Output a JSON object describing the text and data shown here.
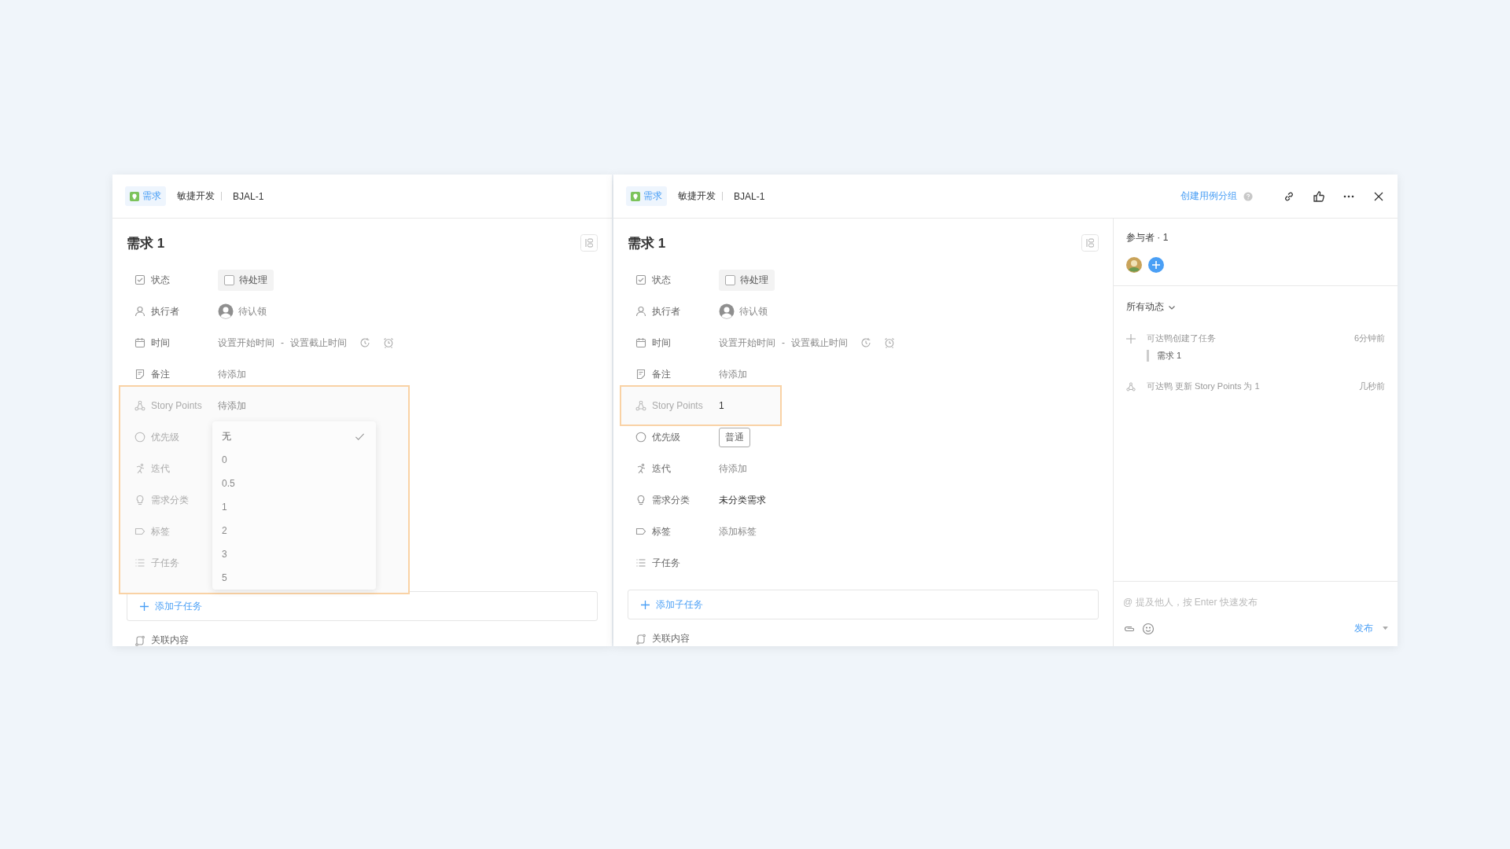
{
  "panels": [
    {
      "header": {
        "type_badge": "需求",
        "project": "敏捷开发",
        "key": "BJAL-1"
      },
      "title": "需求 1",
      "fields": [
        {
          "kind": "status",
          "label": "状态",
          "value": "待处理",
          "checked": false,
          "highlighted": false
        },
        {
          "kind": "assignee",
          "label": "执行者",
          "placeholder": "待认领",
          "highlighted": false
        },
        {
          "kind": "time",
          "label": "时间",
          "start_placeholder": "设置开始时间",
          "separator": "-",
          "end_placeholder": "设置截止时间",
          "highlighted": false
        },
        {
          "kind": "note",
          "label": "备注",
          "placeholder": "待添加",
          "highlighted": false
        },
        {
          "kind": "points",
          "label": "Story Points",
          "placeholder": "待添加",
          "highlighted": true
        },
        {
          "kind": "priority",
          "label": "优先级",
          "highlighted": true
        },
        {
          "kind": "iteration",
          "label": "迭代",
          "highlighted": true
        },
        {
          "kind": "category",
          "label": "需求分类",
          "highlighted": true
        },
        {
          "kind": "tags",
          "label": "标签",
          "highlighted": true
        },
        {
          "kind": "subtasks",
          "label": "子任务",
          "highlighted": true
        }
      ],
      "dropdown": {
        "options": [
          {
            "label": "无",
            "selected": true
          },
          {
            "label": "0",
            "selected": false
          },
          {
            "label": "0.5",
            "selected": false
          },
          {
            "label": "1",
            "selected": false
          },
          {
            "label": "2",
            "selected": false
          },
          {
            "label": "3",
            "selected": false
          },
          {
            "label": "5",
            "selected": false
          }
        ]
      },
      "add_subtask": "添加子任务",
      "related": "关联内容"
    },
    {
      "header": {
        "type_badge": "需求",
        "project": "敏捷开发",
        "key": "BJAL-1",
        "action_link": "创建用例分组"
      },
      "title": "需求 1",
      "fields": [
        {
          "kind": "status",
          "label": "状态",
          "value": "待处理",
          "checked": false,
          "highlighted": false
        },
        {
          "kind": "assignee",
          "label": "执行者",
          "placeholder": "待认领",
          "highlighted": false
        },
        {
          "kind": "time",
          "label": "时间",
          "start_placeholder": "设置开始时间",
          "separator": "-",
          "end_placeholder": "设置截止时间",
          "highlighted": false
        },
        {
          "kind": "note",
          "label": "备注",
          "placeholder": "待添加",
          "highlighted": false
        },
        {
          "kind": "points",
          "label": "Story Points",
          "value": "1",
          "highlighted": true
        },
        {
          "kind": "priority",
          "label": "优先级",
          "tag": "普通",
          "highlighted": false
        },
        {
          "kind": "iteration",
          "label": "迭代",
          "placeholder": "待添加",
          "highlighted": false
        },
        {
          "kind": "category",
          "label": "需求分类",
          "value": "未分类需求",
          "highlighted": false
        },
        {
          "kind": "tags",
          "label": "标签",
          "placeholder": "添加标签",
          "highlighted": false
        },
        {
          "kind": "subtasks",
          "label": "子任务",
          "highlighted": false
        }
      ],
      "add_subtask": "添加子任务",
      "related": "关联内容",
      "sidebar": {
        "participants_title": "参与者 · 1",
        "activity_filter": "所有动态",
        "activities": [
          {
            "kind": "create",
            "text": "可达鸭创建了任务",
            "quote": "需求 1",
            "time": "6分钟前"
          },
          {
            "kind": "update",
            "text": "可达鸭 更新 Story Points 为 1",
            "time": "几秒前"
          }
        ],
        "comment_placeholder": "@ 提及他人，按 Enter 快速发布",
        "publish": "发布"
      }
    }
  ]
}
